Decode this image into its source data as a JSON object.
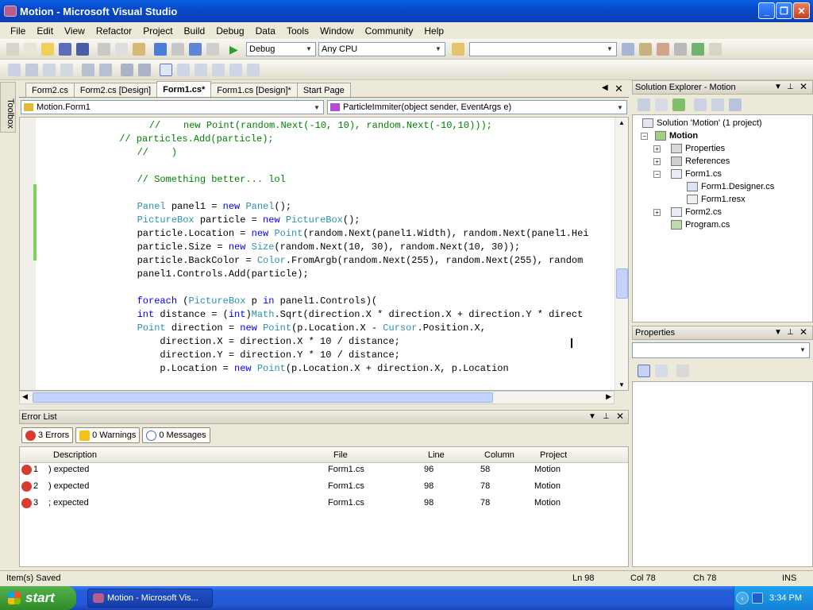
{
  "window": {
    "title": "Motion - Microsoft Visual Studio"
  },
  "menu": [
    "File",
    "Edit",
    "View",
    "Refactor",
    "Project",
    "Build",
    "Debug",
    "Data",
    "Tools",
    "Window",
    "Community",
    "Help"
  ],
  "toolbar": {
    "config": "Debug",
    "platform": "Any CPU",
    "find_value": ""
  },
  "toolbox_label": "Toolbox",
  "doc_tabs": [
    "Form2.cs",
    "Form2.cs [Design]",
    "Form1.cs*",
    "Form1.cs [Design]*",
    "Start Page"
  ],
  "nav": {
    "class": "Motion.Form1",
    "member": "ParticleImmiter(object sender, EventArgs e)"
  },
  "code_lines": [
    {
      "segments": [
        {
          "t": "    //    new ",
          "c": "cm"
        },
        {
          "t": "Point(random.Next(-10, 10), random.Next(-10,10)));",
          "c": "cm"
        }
      ]
    },
    {
      "segments": [
        {
          "t": " // particles.Add(particle);",
          "c": "cm"
        }
      ]
    },
    {
      "segments": [
        {
          "t": "   //    )",
          "c": "cm"
        }
      ]
    },
    {
      "segments": [
        {
          "t": "",
          "c": ""
        }
      ]
    },
    {
      "segments": [
        {
          "t": "   // Something better... lol",
          "c": "cm"
        }
      ]
    },
    {
      "segments": [
        {
          "t": "",
          "c": ""
        }
      ]
    },
    {
      "segments": [
        {
          "t": "   ",
          "c": ""
        },
        {
          "t": "Panel",
          "c": "ty"
        },
        {
          "t": " panel1 = ",
          "c": ""
        },
        {
          "t": "new",
          "c": "kw"
        },
        {
          "t": " ",
          "c": ""
        },
        {
          "t": "Panel",
          "c": "ty"
        },
        {
          "t": "();",
          "c": ""
        }
      ]
    },
    {
      "segments": [
        {
          "t": "   ",
          "c": ""
        },
        {
          "t": "PictureBox",
          "c": "ty"
        },
        {
          "t": " particle = ",
          "c": ""
        },
        {
          "t": "new",
          "c": "kw"
        },
        {
          "t": " ",
          "c": ""
        },
        {
          "t": "PictureBox",
          "c": "ty"
        },
        {
          "t": "();",
          "c": ""
        }
      ]
    },
    {
      "segments": [
        {
          "t": "   particle.Location = ",
          "c": ""
        },
        {
          "t": "new",
          "c": "kw"
        },
        {
          "t": " ",
          "c": ""
        },
        {
          "t": "Point",
          "c": "ty"
        },
        {
          "t": "(random.Next(panel1.Width), random.Next(panel1.Hei",
          "c": ""
        }
      ]
    },
    {
      "segments": [
        {
          "t": "   particle.Size = ",
          "c": ""
        },
        {
          "t": "new",
          "c": "kw"
        },
        {
          "t": " ",
          "c": ""
        },
        {
          "t": "Size",
          "c": "ty"
        },
        {
          "t": "(random.Next(10, 30), random.Next(10, 30));",
          "c": ""
        }
      ]
    },
    {
      "segments": [
        {
          "t": "   particle.BackColor = ",
          "c": ""
        },
        {
          "t": "Color",
          "c": "ty"
        },
        {
          "t": ".FromArgb(random.Next(255), random.Next(255), random",
          "c": ""
        }
      ]
    },
    {
      "segments": [
        {
          "t": "   panel1.Controls.Add(particle);",
          "c": ""
        }
      ]
    },
    {
      "segments": [
        {
          "t": "",
          "c": ""
        }
      ]
    },
    {
      "segments": [
        {
          "t": "   ",
          "c": ""
        },
        {
          "t": "foreach",
          "c": "kw"
        },
        {
          "t": " (",
          "c": ""
        },
        {
          "t": "PictureBox",
          "c": "ty"
        },
        {
          "t": " p ",
          "c": ""
        },
        {
          "t": "in",
          "c": "kw"
        },
        {
          "t": " panel1.Controls)(",
          "c": ""
        }
      ]
    },
    {
      "segments": [
        {
          "t": "   ",
          "c": ""
        },
        {
          "t": "int",
          "c": "kw"
        },
        {
          "t": " distance = (",
          "c": ""
        },
        {
          "t": "int",
          "c": "kw"
        },
        {
          "t": ")",
          "c": ""
        },
        {
          "t": "Math",
          "c": "ty"
        },
        {
          "t": ".Sqrt(direction.X * direction.X + direction.Y * direct",
          "c": ""
        }
      ]
    },
    {
      "segments": [
        {
          "t": "   ",
          "c": ""
        },
        {
          "t": "Point",
          "c": "ty"
        },
        {
          "t": " direction = ",
          "c": ""
        },
        {
          "t": "new",
          "c": "kw"
        },
        {
          "t": " ",
          "c": ""
        },
        {
          "t": "Point",
          "c": "ty"
        },
        {
          "t": "(p.Location.X - ",
          "c": ""
        },
        {
          "t": "Cursor",
          "c": "ty"
        },
        {
          "t": ".Position.X,",
          "c": ""
        }
      ]
    },
    {
      "segments": [
        {
          "t": "       direction.X = direction.X * 10 / distance;",
          "c": ""
        }
      ]
    },
    {
      "segments": [
        {
          "t": "       direction.Y = direction.Y * 10 / distance;",
          "c": ""
        }
      ]
    },
    {
      "segments": [
        {
          "t": "       p.Location = ",
          "c": ""
        },
        {
          "t": "new",
          "c": "kw"
        },
        {
          "t": " ",
          "c": ""
        },
        {
          "t": "Point",
          "c": "ty"
        },
        {
          "t": "(p.Location.X + direction.X, p.Location",
          "c": ""
        }
      ]
    }
  ],
  "error_list": {
    "title": "Error List",
    "errors_btn": "3 Errors",
    "warnings_btn": "0 Warnings",
    "messages_btn": "0 Messages",
    "columns": [
      "Description",
      "File",
      "Line",
      "Column",
      "Project"
    ],
    "rows": [
      {
        "n": "1",
        "desc": ") expected",
        "file": "Form1.cs",
        "line": "96",
        "col": "58",
        "project": "Motion"
      },
      {
        "n": "2",
        "desc": ") expected",
        "file": "Form1.cs",
        "line": "98",
        "col": "78",
        "project": "Motion"
      },
      {
        "n": "3",
        "desc": "; expected",
        "file": "Form1.cs",
        "line": "98",
        "col": "78",
        "project": "Motion"
      }
    ]
  },
  "solution_explorer": {
    "title": "Solution Explorer - Motion",
    "nodes": [
      {
        "label": "Solution 'Motion' (1 project)",
        "bold": false
      },
      {
        "label": "Motion",
        "bold": true
      },
      {
        "label": "Properties",
        "bold": false
      },
      {
        "label": "References",
        "bold": false
      },
      {
        "label": "Form1.cs",
        "bold": false
      },
      {
        "label": "Form1.Designer.cs",
        "bold": false
      },
      {
        "label": "Form1.resx",
        "bold": false
      },
      {
        "label": "Form2.cs",
        "bold": false
      },
      {
        "label": "Program.cs",
        "bold": false
      }
    ]
  },
  "properties": {
    "title": "Properties",
    "selected": ""
  },
  "status": {
    "message": "Item(s) Saved",
    "ln": "Ln 98",
    "col": "Col 78",
    "ch": "Ch 78",
    "mode": "INS"
  },
  "taskbar": {
    "start": "start",
    "item": "Motion - Microsoft Vis...",
    "clock": "3:34 PM"
  },
  "colors": {
    "title_bar": "#0747c8",
    "keyword": "#0000ff",
    "type": "#2b91af",
    "comment": "#008000",
    "error": "#d63c2f"
  }
}
